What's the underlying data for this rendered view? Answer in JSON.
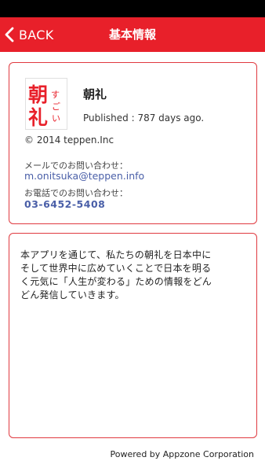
{
  "nav": {
    "back_label": "BACK",
    "title": "基本情報"
  },
  "app": {
    "icon_text": "朝礼 すごい",
    "name": "朝礼",
    "published": "Published : 787 days ago.",
    "copyright": "© 2014 teppen.Inc"
  },
  "contact": {
    "mail_label": "メールでのお問い合わせ：",
    "mail": "m.onitsuka@teppen.info",
    "phone_label": "お電話でのお問い合わせ：",
    "phone": "03-6452-5408"
  },
  "description": {
    "line1": "本アプリを通じて、私たちの朝礼を日本中に",
    "line2": "そして世界中に広めていくことで日本を明る",
    "line3": "く元気に「人生が変わる」ための情報をどん",
    "line4": "どん発信していきます。"
  },
  "footer": {
    "text": "Powered by Appzone Corporation"
  },
  "colors": {
    "nav_background": "#e8202a",
    "card_border": "#e03a40",
    "link": "#4a5fa8"
  },
  "icons": {
    "back": "chevron-left-icon",
    "app": "chourei-app-logo"
  }
}
